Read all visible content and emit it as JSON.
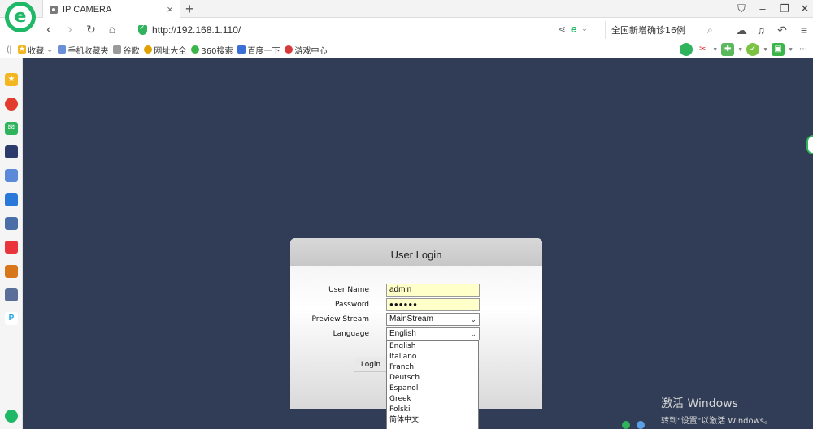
{
  "browser": {
    "tab": {
      "title": "IP CAMERA",
      "close_glyph": "×"
    },
    "new_tab_glyph": "+",
    "window_controls": [
      "⛉",
      "–",
      "❐",
      "✕"
    ],
    "url": "http://192.168.1.110/",
    "search_text": "全国新增确诊16例",
    "bookmarks": [
      {
        "label": "收藏",
        "icon": "star-icon",
        "color": "#f2b720"
      },
      {
        "label": "手机收藏夹",
        "icon": "phone-icon",
        "color": "#6a8fd8"
      },
      {
        "label": "谷歌",
        "icon": "page-icon",
        "color": "#9a9a9a"
      },
      {
        "label": "网址大全",
        "icon": "globe-icon",
        "color": "#e0a000"
      },
      {
        "label": "360搜索",
        "icon": "search-360-icon",
        "color": "#3bb54a"
      },
      {
        "label": "百度一下",
        "icon": "paw-icon",
        "color": "#3a6fd8"
      },
      {
        "label": "游戏中心",
        "icon": "game-icon",
        "color": "#d83a3a"
      }
    ]
  },
  "login": {
    "title": "User Login",
    "username_label": "User Name",
    "username_value": "admin",
    "password_label": "Password",
    "password_value": "●●●●●●",
    "stream_label": "Preview Stream",
    "stream_value": "MainStream",
    "language_label": "Language",
    "language_value": "English",
    "login_button": "Login",
    "language_options": [
      "English",
      "Italiano",
      "Franch",
      "Deutsch",
      "Espanol",
      "Greek",
      "Polski",
      "简体中文"
    ]
  },
  "watermark": {
    "line1": "激活 Windows",
    "line2": "转到\"设置\"以激活 Windows。"
  },
  "colors": {
    "content_bg": "#313d56",
    "brand_green": "#1fb866",
    "input_highlight": "#ffffc9"
  }
}
